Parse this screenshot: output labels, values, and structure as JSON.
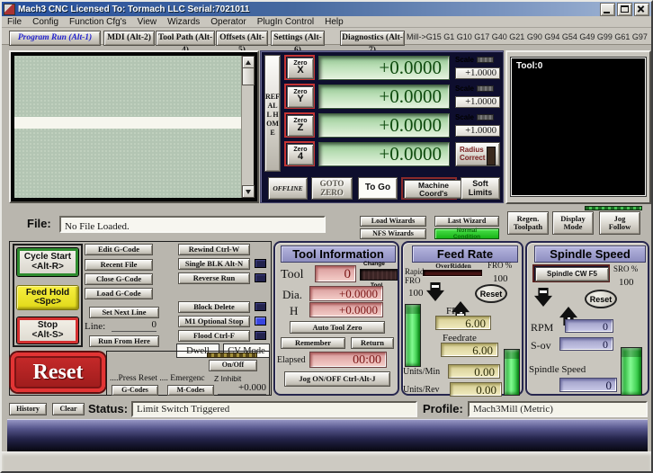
{
  "window": {
    "title": "Mach3 CNC  Licensed To: Tormach LLC Serial:7021011"
  },
  "menu": {
    "items": [
      "File",
      "Config",
      "Function Cfg's",
      "View",
      "Wizards",
      "Operator",
      "PlugIn Control",
      "Help"
    ]
  },
  "tabs": {
    "program_run": "Program Run (Alt-1)",
    "mdi": "MDI (Alt-2)",
    "tool_path": "Tool Path (Alt-4)",
    "offsets": "Offsets (Alt-5)",
    "settings": "Settings (Alt-6)",
    "diagnostics": "Diagnostics (Alt-7)",
    "modes": "Mill->G15 G1 G10 G17 G40 G21 G90 G94 G54 G49 G99 G61 G97"
  },
  "dro": {
    "ref_all_home": "REF ALL HOME",
    "zero_label": "Zero",
    "axes": [
      {
        "axis": "X",
        "value": "+0.0000",
        "scale_label": "Scale",
        "scale": "+1.0000"
      },
      {
        "axis": "Y",
        "value": "+0.0000",
        "scale_label": "Scale",
        "scale": "+1.0000"
      },
      {
        "axis": "Z",
        "value": "+0.0000",
        "scale_label": "Scale",
        "scale": "+1.0000"
      },
      {
        "axis": "4",
        "value": "+0.0000"
      }
    ],
    "radius_correct": "Radius Correct",
    "offline": "OFFLINE",
    "goto_zero": "GOTO ZERO",
    "to_go": "To Go",
    "machine_coords": "Machine Coord's",
    "soft_limits": "Soft Limits"
  },
  "toolpath": {
    "tool_label": "Tool:0",
    "regen": "Regen. Toolpath",
    "display_mode": "Display Mode",
    "jog_follow": "Jog Follow"
  },
  "file_bar": {
    "label": "File:",
    "value": "No File Loaded.",
    "load_wizards": "Load Wizards",
    "last_wizard": "Last Wizard",
    "nfs_wizards": "NFS Wizards",
    "normal_condition": "Normal Condition"
  },
  "run_controls": {
    "cycle_start": "Cycle Start",
    "cycle_start_key": "<Alt-R>",
    "feed_hold": "Feed Hold",
    "feed_hold_key": "<Spc>",
    "stop": "Stop",
    "stop_key": "<Alt-S>",
    "reset": "Reset"
  },
  "gcode_controls": {
    "edit": "Edit G-Code",
    "recent": "Recent File",
    "close": "Close G-Code",
    "load": "Load G-Code",
    "set_next_line": "Set Next Line",
    "line_label": "Line:",
    "line_value": "0",
    "run_from_here": "Run From Here",
    "rewind": "Rewind Ctrl-W",
    "single_blk": "Single BLK Alt-N",
    "reverse_run": "Reverse Run",
    "block_delete": "Block Delete",
    "m1_optional": "M1 Optional Stop",
    "flood": "Flood Ctrl-F",
    "dwell": "Dwell",
    "cv_mode": "CV Mode",
    "on_off": "On/Off",
    "reset_message": "....Press Reset .... Emergenc",
    "z_inhibit_label": "Z Inhibit",
    "z_inhibit_value": "+0.000",
    "g_codes": "G-Codes",
    "m_codes": "M-Codes"
  },
  "tool_info": {
    "title": "Tool Information",
    "tool_label": "Tool",
    "tool_value": "0",
    "change_label": "Change",
    "change_tool_label": "Tool",
    "dia_label": "Dia.",
    "dia_value": "+0.0000",
    "h_label": "H",
    "h_value": "+0.0000",
    "auto_tool_zero": "Auto Tool Zero",
    "remember": "Remember",
    "return": "Return",
    "elapsed_label": "Elapsed",
    "elapsed_value": "00:00",
    "jog_toggle": "Jog ON/OFF Ctrl-Alt-J"
  },
  "feed_rate": {
    "title": "Feed Rate",
    "overridden_label": "OverRidden",
    "fro_pct_label": "FRO %",
    "fro_pct_value": "100",
    "rapid_line1": "Rapid",
    "rapid_line2": "FRO",
    "rapid_value": "100",
    "reset": "Reset",
    "fro_label": "FRO",
    "fro_value": "6.00",
    "feedrate_label": "Feedrate",
    "feedrate_value": "6.00",
    "units_min_label": "Units/Min",
    "units_min_value": "0.00",
    "units_rev_label": "Units/Rev",
    "units_rev_value": "0.00"
  },
  "spindle": {
    "title": "Spindle Speed",
    "cw_button": "Spindle CW F5",
    "sro_label": "SRO %",
    "sro_value": "100",
    "reset": "Reset",
    "rpm_label": "RPM",
    "rpm_value": "0",
    "sov_label": "S-ov",
    "sov_value": "0",
    "speed_label": "Spindle Speed",
    "speed_value": "0"
  },
  "status_bar": {
    "history": "History",
    "clear": "Clear",
    "status_label": "Status:",
    "status_value": "Limit Switch Triggered",
    "profile_label": "Profile:",
    "profile_value": "Mach3Mill (Metric)"
  },
  "colors": {
    "dro_green_text": "#0d4a0d",
    "accent_red": "#cc2222",
    "led_blue": "#3946e0",
    "slider_green": "#22dd44",
    "header_lavender": "#9a9ace",
    "titlebar_blue": "#27509e"
  }
}
